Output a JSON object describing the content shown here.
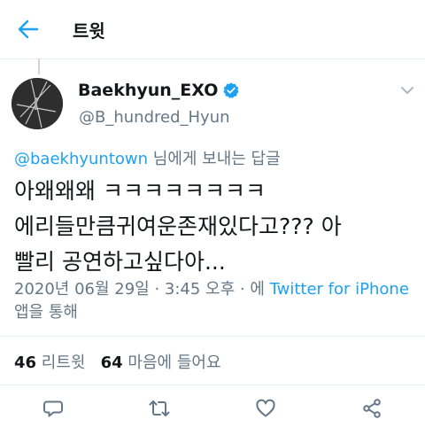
{
  "header": {
    "title": "트윗",
    "back_icon": "arrow-left-icon"
  },
  "author": {
    "display_name": "Baekhyun_EXO",
    "handle": "@B_hundred_Hyun",
    "verified_icon": "verified-badge-icon"
  },
  "reply_to": {
    "mention": "@baekhyuntown",
    "suffix": " 님에게 보내는 답글"
  },
  "tweet": {
    "text": "아왜왜왜 ㅋㅋㅋㅋㅋㅋㅋㅋ\n에리들만큼귀여운존재있다고??? 아\n빨리 공연하고싶다아..."
  },
  "meta": {
    "date_time": "2020년 06월 29일 · 3:45 오후 · 에 ",
    "source": "Twitter for iPhone",
    "suffix": " 앱을 통해"
  },
  "stats": {
    "retweets_count": "46",
    "retweets_label": " 리트윗",
    "likes_count": "64",
    "likes_label": " 마음에 들어요"
  },
  "actions": [
    "reply-icon",
    "retweet-icon",
    "like-icon",
    "share-icon"
  ],
  "colors": {
    "accent": "#1da1f2",
    "secondary_text": "#657786",
    "primary_text": "#14171a"
  }
}
